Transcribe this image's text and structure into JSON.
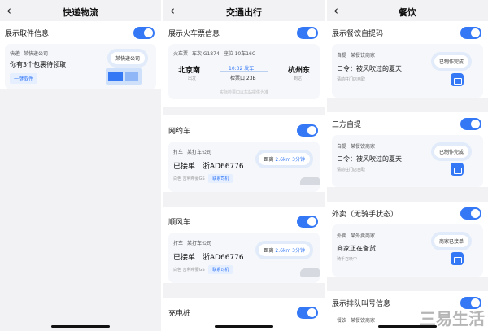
{
  "express": {
    "title": "快递物流",
    "toggle_label": "展示取件信息",
    "card": {
      "line1_a": "快递",
      "line1_b": "某快递公司",
      "message": "你有3个包裹待领取",
      "button": "一键取件",
      "badge": "某快递公司"
    }
  },
  "transport": {
    "title": "交通出行",
    "train": {
      "toggle_label": "展示火车票信息",
      "header_a": "火车票",
      "header_b": "车次 G1874",
      "header_c": "座位 10车16C",
      "from": "北京南",
      "from_sub": "出发",
      "to": "杭州东",
      "to_sub": "到达",
      "depart": "10:32 发车",
      "gate": "检票口 23B",
      "note": "实际检票口以车站提供为准"
    },
    "ride": {
      "toggle_label": "网约车",
      "header_a": "打车",
      "header_b": "某打车公司",
      "status": "已接单",
      "plate": "浙AD66776",
      "car": "白色 吉利帝豪GS",
      "contact": "联系司机",
      "distance_label": "距离",
      "distance": "2.6km 3分钟"
    },
    "hitch": {
      "toggle_label": "顺风车",
      "header_a": "打车",
      "header_b": "某打车公司",
      "status": "已接单",
      "plate": "浙AD66776",
      "car": "白色 吉利帝豪GS",
      "contact": "联系司机",
      "distance_label": "距离",
      "distance": "2.6km 3分钟"
    },
    "charging": {
      "toggle_label": "充电桩"
    }
  },
  "dining": {
    "title": "餐饮",
    "pickup": {
      "toggle_label": "展示餐饮自提码",
      "header_a": "自提",
      "header_b": "某餐饮商家",
      "code": "口令：被风吹过的夏天",
      "sub": "请前往门店自取",
      "badge": "已制作完成"
    },
    "third": {
      "toggle_label": "三方自提",
      "header_a": "自提",
      "header_b": "某餐饮商家",
      "code": "口令：被风吹过的夏天",
      "sub": "请前往门店自取",
      "badge": "已制作完成"
    },
    "takeout": {
      "toggle_label": "外卖（无骑手状态）",
      "header_a": "外卖",
      "header_b": "某外卖商家",
      "status": "商家正在备货",
      "sub": "骑手召唤中",
      "badge": "商家已接单"
    },
    "queue": {
      "toggle_label": "展示排队叫号信息",
      "header_a": "餐饮",
      "header_b": "某餐饮商家"
    }
  },
  "watermark": "三易生活"
}
